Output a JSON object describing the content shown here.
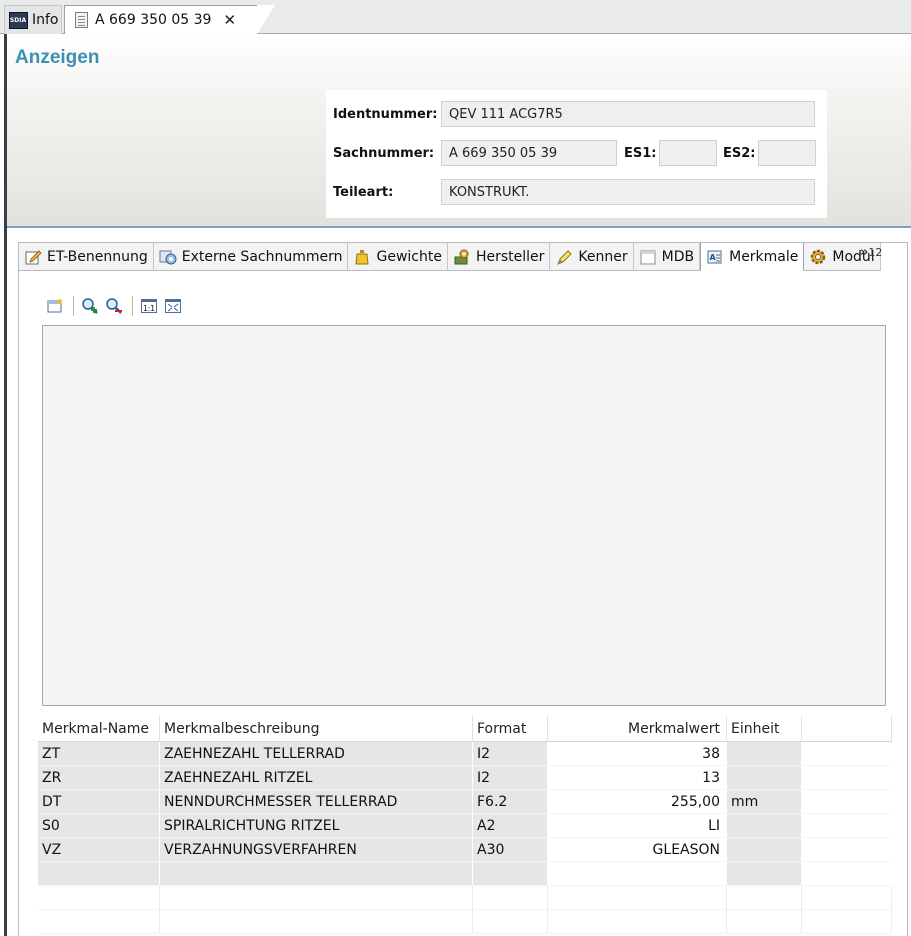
{
  "editor_tabs": [
    {
      "label": "Info",
      "icon": "sdia-logo-icon"
    },
    {
      "label": "A 669 350 05 39",
      "icon": "document-icon"
    }
  ],
  "info_logo_text": "SDIA",
  "header": {
    "title": "Anzeigen",
    "identnummer_label": "Identnummer:",
    "identnummer_value": "QEV 111 ACG7R5",
    "sachnummer_label": "Sachnummer:",
    "sachnummer_value": "A 669 350 05 39",
    "es1_label": "ES1:",
    "es1_value": "",
    "es2_label": "ES2:",
    "es2_value": "",
    "teileart_label": "Teileart:",
    "teileart_value": "KONSTRUKT."
  },
  "tabs": [
    {
      "label": "ET-Benennung",
      "icon": "edit-document-icon"
    },
    {
      "label": "Externe Sachnummern",
      "icon": "external-numbers-icon"
    },
    {
      "label": "Gewichte",
      "icon": "weight-icon"
    },
    {
      "label": "Hersteller",
      "icon": "manufacturer-icon"
    },
    {
      "label": "Kenner",
      "icon": "marker-icon"
    },
    {
      "label": "MDB",
      "icon": "window-icon"
    },
    {
      "label": "Merkmale",
      "icon": "features-icon"
    },
    {
      "label": "Modul",
      "icon": "gear-icon"
    }
  ],
  "more_tabs": {
    "symbol": "»",
    "count": "12"
  },
  "toolbar": [
    {
      "icon": "new-window-icon"
    },
    {
      "icon": "zoom-in-icon"
    },
    {
      "icon": "zoom-out-icon"
    },
    {
      "icon": "actual-size-icon",
      "label": "1:1"
    },
    {
      "icon": "fit-to-window-icon"
    }
  ],
  "table": {
    "columns": [
      "Merkmal-Name",
      "Merkmalbeschreibung",
      "Format",
      "Merkmalwert",
      "Einheit"
    ],
    "rows": [
      {
        "name": "ZT",
        "desc": "ZAEHNEZAHL TELLERRAD",
        "format": "I2",
        "value": "38",
        "unit": ""
      },
      {
        "name": "ZR",
        "desc": "ZAEHNEZAHL RITZEL",
        "format": "I2",
        "value": "13",
        "unit": ""
      },
      {
        "name": "DT",
        "desc": "NENNDURCHMESSER TELLERRAD",
        "format": "F6.2",
        "value": "255,00",
        "unit": "mm"
      },
      {
        "name": "S0",
        "desc": "SPIRALRICHTUNG RITZEL",
        "format": "A2",
        "value": "LI",
        "unit": ""
      },
      {
        "name": "VZ",
        "desc": "VERZAHNUNGSVERFAHREN",
        "format": "A30",
        "value": "GLEASON",
        "unit": ""
      }
    ]
  },
  "colors": {
    "title": "#3d8fb3",
    "header_rule": "#7f9fba",
    "cell_gray": "#e6e6e6"
  }
}
